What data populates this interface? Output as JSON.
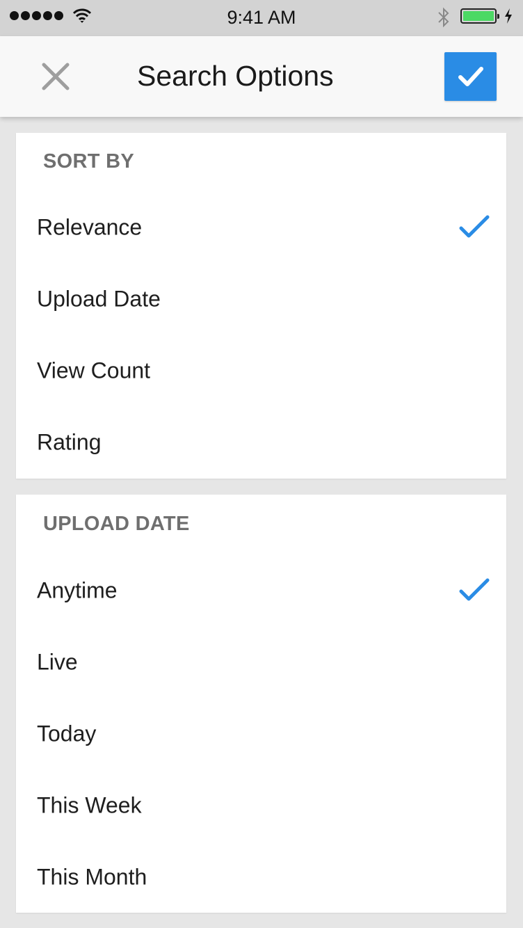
{
  "status_bar": {
    "time": "9:41 AM",
    "signal_icon": "signal-dots-icon",
    "wifi_icon": "wifi-icon",
    "bluetooth_icon": "bluetooth-icon",
    "battery_icon": "battery-icon",
    "charging_icon": "charging-bolt-icon",
    "battery_level_percent": 100,
    "battery_color": "#4cd964"
  },
  "header": {
    "title": "Search Options",
    "close_icon": "close-icon",
    "confirm_icon": "checkmark-icon",
    "accent_color": "#2a8ce5"
  },
  "sections": [
    {
      "title": "SORT BY",
      "options": [
        {
          "label": "Relevance",
          "selected": true
        },
        {
          "label": "Upload Date",
          "selected": false
        },
        {
          "label": "View Count",
          "selected": false
        },
        {
          "label": "Rating",
          "selected": false
        }
      ]
    },
    {
      "title": "UPLOAD DATE",
      "options": [
        {
          "label": "Anytime",
          "selected": true
        },
        {
          "label": "Live",
          "selected": false
        },
        {
          "label": "Today",
          "selected": false
        },
        {
          "label": "This Week",
          "selected": false
        },
        {
          "label": "This Month",
          "selected": false
        }
      ]
    }
  ]
}
